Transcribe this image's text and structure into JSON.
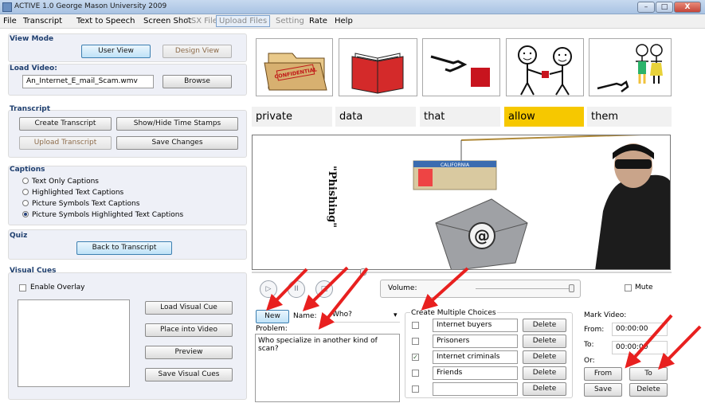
{
  "window": {
    "title": "ACTIVE 1.0 George Mason University 2009"
  },
  "window_controls": {
    "minimize": "–",
    "maximize": "□",
    "close": "X"
  },
  "menu": [
    {
      "label": "File",
      "state": "normal"
    },
    {
      "label": "Transcript",
      "state": "normal"
    },
    {
      "label": "Text to Speech",
      "state": "normal"
    },
    {
      "label": "Screen Shot",
      "state": "normal"
    },
    {
      "label": "ASX File",
      "state": "disabled"
    },
    {
      "label": "Upload Files",
      "state": "boxed"
    },
    {
      "label": "Setting",
      "state": "disabled"
    },
    {
      "label": "Rate",
      "state": "normal"
    },
    {
      "label": "Help",
      "state": "normal"
    }
  ],
  "view_mode": {
    "label": "View Mode",
    "user_view": "User View",
    "design_view": "Design View"
  },
  "load_video": {
    "label": "Load Video:",
    "filename": "An_Internet_E_mail_Scam.wmv",
    "browse": "Browse"
  },
  "transcript": {
    "label": "Transcript",
    "create": "Create Transcript",
    "show_hide": "Show/Hide Time Stamps",
    "upload": "Upload Transcript",
    "save": "Save Changes"
  },
  "captions": {
    "label": "Captions",
    "options": [
      {
        "label": "Text Only Captions",
        "selected": false
      },
      {
        "label": "Highlighted Text Captions",
        "selected": false
      },
      {
        "label": "Picture Symbols Text Captions",
        "selected": false
      },
      {
        "label": "Picture Symbols Highlighted Text Captions",
        "selected": true
      }
    ]
  },
  "quiz": {
    "label": "Quiz",
    "back": "Back to Transcript"
  },
  "visual_cues": {
    "label": "Visual Cues",
    "enable_overlay": "Enable Overlay",
    "load": "Load Visual Cue",
    "place": "Place into Video",
    "preview": "Preview",
    "save": "Save Visual Cues"
  },
  "symbols": {
    "icons": [
      "confidential-folder-icon",
      "open-book-icon",
      "hand-pointing-square-icon",
      "two-people-exchange-icon",
      "two-people-pointing-icon"
    ],
    "confidential_stamp": "CONFIDENTIAL"
  },
  "caption_words": [
    {
      "text": "private",
      "highlight": false
    },
    {
      "text": "data",
      "highlight": false
    },
    {
      "text": "that",
      "highlight": false
    },
    {
      "text": "allow",
      "highlight": true
    },
    {
      "text": "them",
      "highlight": false
    }
  ],
  "video": {
    "phishing_text": "\"Phishing\"",
    "at_symbol": "@",
    "card_text": "CALIFORNIA"
  },
  "player": {
    "volume_label": "Volume:",
    "mute_label": "Mute",
    "play": "▷",
    "pause": "II",
    "stop": "□"
  },
  "question": {
    "new_label": "New",
    "name_label": "Name:",
    "name_value": "Who?",
    "problem_label": "Problem:",
    "problem_text": "Who specialize in another kind of scan?"
  },
  "choices": {
    "label": "Create Multiple Choices",
    "delete_label": "Delete",
    "items": [
      {
        "text": "Internet buyers",
        "checked": false
      },
      {
        "text": "Prisoners",
        "checked": false
      },
      {
        "text": "Internet criminals",
        "checked": true
      },
      {
        "text": "Friends",
        "checked": false
      },
      {
        "text": "",
        "checked": false
      }
    ]
  },
  "mark_video": {
    "label": "Mark Video:",
    "from_label": "From:",
    "from_value": "00:00:00",
    "to_label": "To:",
    "to_value": "00:00:00",
    "or_label": "Or:",
    "from_btn": "From",
    "to_btn": "To",
    "save_btn": "Save",
    "delete_btn": "Delete"
  },
  "colors": {
    "caption_highlight": "#f6c800",
    "annotation_arrow": "#e8201f",
    "group_label": "#1f3f6f"
  }
}
